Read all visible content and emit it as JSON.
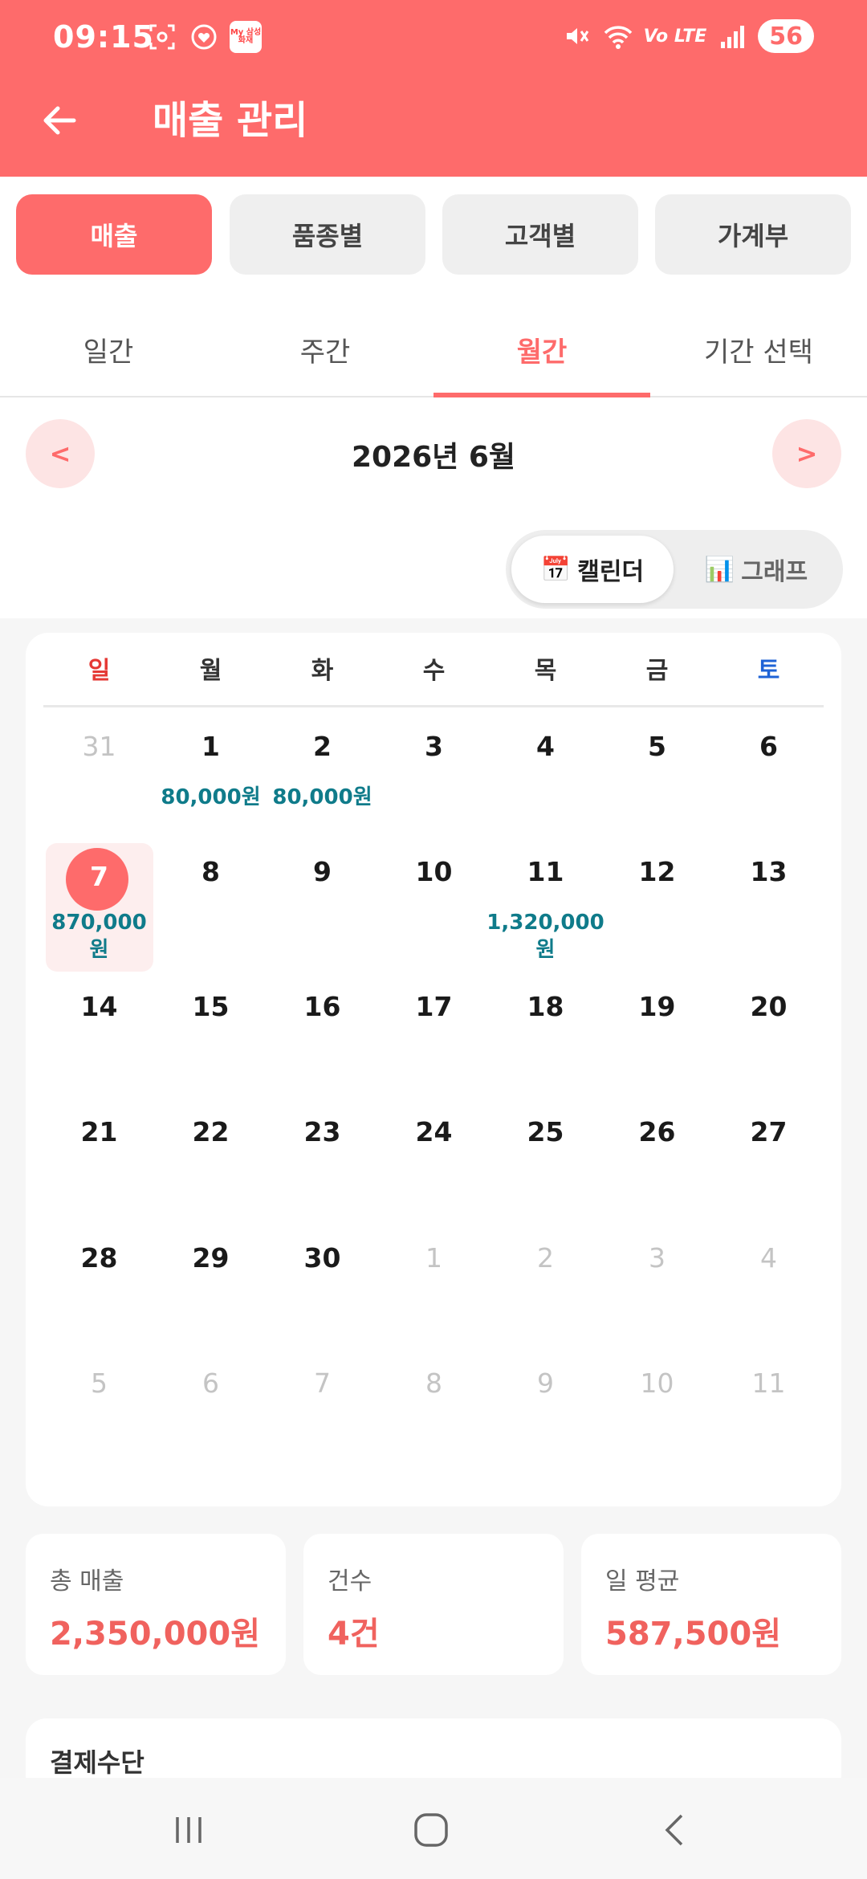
{
  "status_bar": {
    "time": "09:15",
    "battery": "56",
    "network_label": "Vo LTE",
    "app_badge": "My 삼성화재",
    "icons": [
      "screenshot-icon",
      "heart-icon",
      "mute-icon",
      "wifi-icon",
      "signal-icon"
    ]
  },
  "header": {
    "title": "매출 관리",
    "back_icon": "arrow-left-icon"
  },
  "segments": [
    "매출",
    "품종별",
    "고객별",
    "가계부"
  ],
  "segment_selected": "매출",
  "period_tabs": [
    "일간",
    "주간",
    "월간",
    "기간 선택"
  ],
  "period_selected": "월간",
  "month_nav": {
    "prev": "<",
    "next": ">",
    "title": "2026년 6월"
  },
  "view_toggle": {
    "calendar": {
      "icon": "📅",
      "label": "캘린더"
    },
    "graph": {
      "icon": "📊",
      "label": "그래프"
    },
    "selected": "캘린더"
  },
  "calendar": {
    "weekdays": [
      "일",
      "월",
      "화",
      "수",
      "목",
      "금",
      "토"
    ],
    "weeks": [
      [
        {
          "d": "31",
          "dim": true
        },
        {
          "d": "1",
          "amt": "80,000원"
        },
        {
          "d": "2",
          "amt": "80,000원"
        },
        {
          "d": "3"
        },
        {
          "d": "4"
        },
        {
          "d": "5"
        },
        {
          "d": "6"
        }
      ],
      [
        {
          "d": "7",
          "amt": "870,000원",
          "today": true
        },
        {
          "d": "8"
        },
        {
          "d": "9"
        },
        {
          "d": "10"
        },
        {
          "d": "11",
          "amt": "1,320,000원"
        },
        {
          "d": "12"
        },
        {
          "d": "13"
        }
      ],
      [
        {
          "d": "14"
        },
        {
          "d": "15"
        },
        {
          "d": "16"
        },
        {
          "d": "17"
        },
        {
          "d": "18"
        },
        {
          "d": "19"
        },
        {
          "d": "20"
        }
      ],
      [
        {
          "d": "21"
        },
        {
          "d": "22"
        },
        {
          "d": "23"
        },
        {
          "d": "24"
        },
        {
          "d": "25"
        },
        {
          "d": "26"
        },
        {
          "d": "27"
        }
      ],
      [
        {
          "d": "28"
        },
        {
          "d": "29"
        },
        {
          "d": "30"
        },
        {
          "d": "1",
          "dim": true
        },
        {
          "d": "2",
          "dim": true
        },
        {
          "d": "3",
          "dim": true
        },
        {
          "d": "4",
          "dim": true
        }
      ],
      [
        {
          "d": "5",
          "dim": true
        },
        {
          "d": "6",
          "dim": true
        },
        {
          "d": "7",
          "dim": true
        },
        {
          "d": "8",
          "dim": true
        },
        {
          "d": "9",
          "dim": true
        },
        {
          "d": "10",
          "dim": true
        },
        {
          "d": "11",
          "dim": true
        }
      ]
    ]
  },
  "summary": [
    {
      "label": "총 매출",
      "value": "2,350,000원"
    },
    {
      "label": "건수",
      "value": "4건"
    },
    {
      "label": "일 평균",
      "value": "587,500원"
    }
  ],
  "payment": {
    "title": "결제수단"
  },
  "colors": {
    "accent": "#fe6b6b",
    "amount": "#0f7b8a",
    "sunday": "#e53935",
    "saturday": "#1e63d6"
  }
}
